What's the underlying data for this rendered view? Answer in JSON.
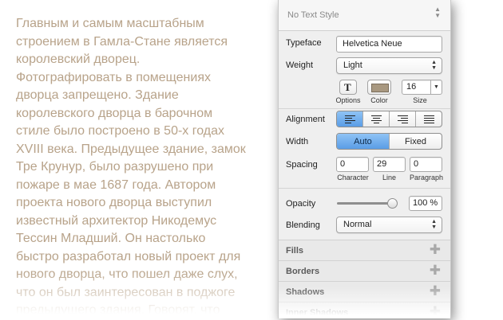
{
  "document": {
    "paragraph": "Главным и самым масштабным\nстроением в Гамла-Стане является\nкоролевский дворец.\nФотографировать в помещениях\nдворца запрещено. Здание\nкоролевского дворца в барочном\nстиле было построено в 50-х годах\nXVIII века. Предыдущее здание, замок\nТре Крунур, было разрушено при\nпожаре в мае 1687 года. Автором\nпроекта нового дворца выступил\nизвестный архитектор Никодемус\nТессин Младший. Он настолько\nбыстро разработал новый проект для\nнового дворца, что пошел даже слух,\nчто он был заинтересован в поджоге\nпредыдущего здания. Говорят, что",
    "text_color": "#b8a38a"
  },
  "inspector": {
    "text_style": "No Text Style",
    "typeface": {
      "label": "Typeface",
      "value": "Helvetica Neue"
    },
    "weight": {
      "label": "Weight",
      "value": "Light"
    },
    "options_label": "Options",
    "color_label": "Color",
    "color_swatch": "#a89880",
    "size": {
      "label": "Size",
      "value": "16"
    },
    "alignment_label": "Alignment",
    "width": {
      "label": "Width",
      "auto": "Auto",
      "fixed": "Fixed"
    },
    "spacing": {
      "label": "Spacing",
      "character": {
        "label": "Character",
        "value": "0"
      },
      "line": {
        "label": "Line",
        "value": "29"
      },
      "paragraph": {
        "label": "Paragraph",
        "value": "0"
      }
    },
    "opacity": {
      "label": "Opacity",
      "value": "100 %",
      "level": 1.0
    },
    "blending": {
      "label": "Blending",
      "value": "Normal"
    },
    "sections": [
      "Fills",
      "Borders",
      "Shadows",
      "Inner Shadows"
    ]
  }
}
